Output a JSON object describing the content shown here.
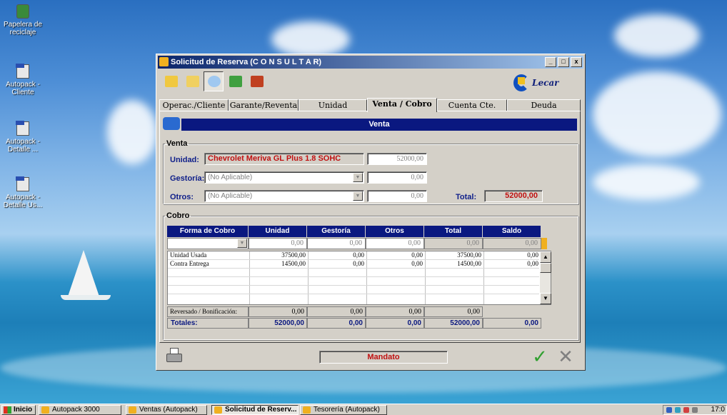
{
  "desktop": {
    "icons": [
      {
        "label": "Papelera de reciclaje",
        "icon": "recycle-bin-icon"
      },
      {
        "label": "Autopack - Cliente",
        "icon": "bmp-file-icon"
      },
      {
        "label": "Autopack - Detalle ...",
        "icon": "bmp-file-icon"
      },
      {
        "label": "Autopack - Detalle Us...",
        "icon": "bmp-file-icon"
      }
    ]
  },
  "window": {
    "title": "Solicitud de Reserva (C O N S U L T A R)",
    "controls": {
      "minimize": "_",
      "maximize": "□",
      "close": "x"
    },
    "toolbar": [
      "new-folder-icon",
      "open-folder-icon",
      "search-icon",
      "recycle-icon",
      "exit-door-icon"
    ],
    "logo_text": "Lecar",
    "tabs": [
      "Operac./Cliente",
      "Garante/Reventa",
      "Unidad",
      "Venta / Cobro",
      "Cuenta Cte.",
      "Deuda"
    ],
    "active_tab": "Venta / Cobro",
    "banner": "Venta",
    "venta": {
      "legend": "Venta",
      "unidad_label": "Unidad:",
      "unidad_value": "Chevrolet Meriva GL Plus 1.8 SOHC",
      "unidad_amount": "52000,00",
      "gestoria_label": "Gestoría:",
      "gestoria_value": "(No Aplicable)",
      "gestoria_amount": "0,00",
      "otros_label": "Otros:",
      "otros_value": "(No Aplicable)",
      "otros_amount": "0,00",
      "total_label": "Total:",
      "total_value": "52000,00"
    },
    "cobro": {
      "legend": "Cobro",
      "columns": [
        "Forma de Cobro",
        "Unidad",
        "Gestoría",
        "Otros",
        "Total",
        "Saldo"
      ],
      "input_row": [
        "",
        "0,00",
        "0,00",
        "0,00",
        "0,00",
        "0,00"
      ],
      "rows": [
        [
          "Unidad Usada",
          "37500,00",
          "0,00",
          "0,00",
          "37500,00",
          "0,00"
        ],
        [
          "Contra Entrega",
          "14500,00",
          "0,00",
          "0,00",
          "14500,00",
          "0,00"
        ]
      ],
      "reversado": [
        "Reversado / Bonificación:",
        "0,00",
        "0,00",
        "0,00",
        "0,00"
      ],
      "totales": [
        "Totales:",
        "52000,00",
        "0,00",
        "0,00",
        "52000,00",
        "0,00"
      ]
    },
    "status": "Mandato",
    "ok_symbol": "✓",
    "cancel_symbol": "✕"
  },
  "taskbar": {
    "start": "Inicio",
    "items": [
      "Autopack 3000",
      "Ventas (Autopack)",
      "Solicitud de Reserv...",
      "Tesorería (Autopack)"
    ],
    "active_item": "Solicitud de Reserv...",
    "clock": "17:0"
  }
}
